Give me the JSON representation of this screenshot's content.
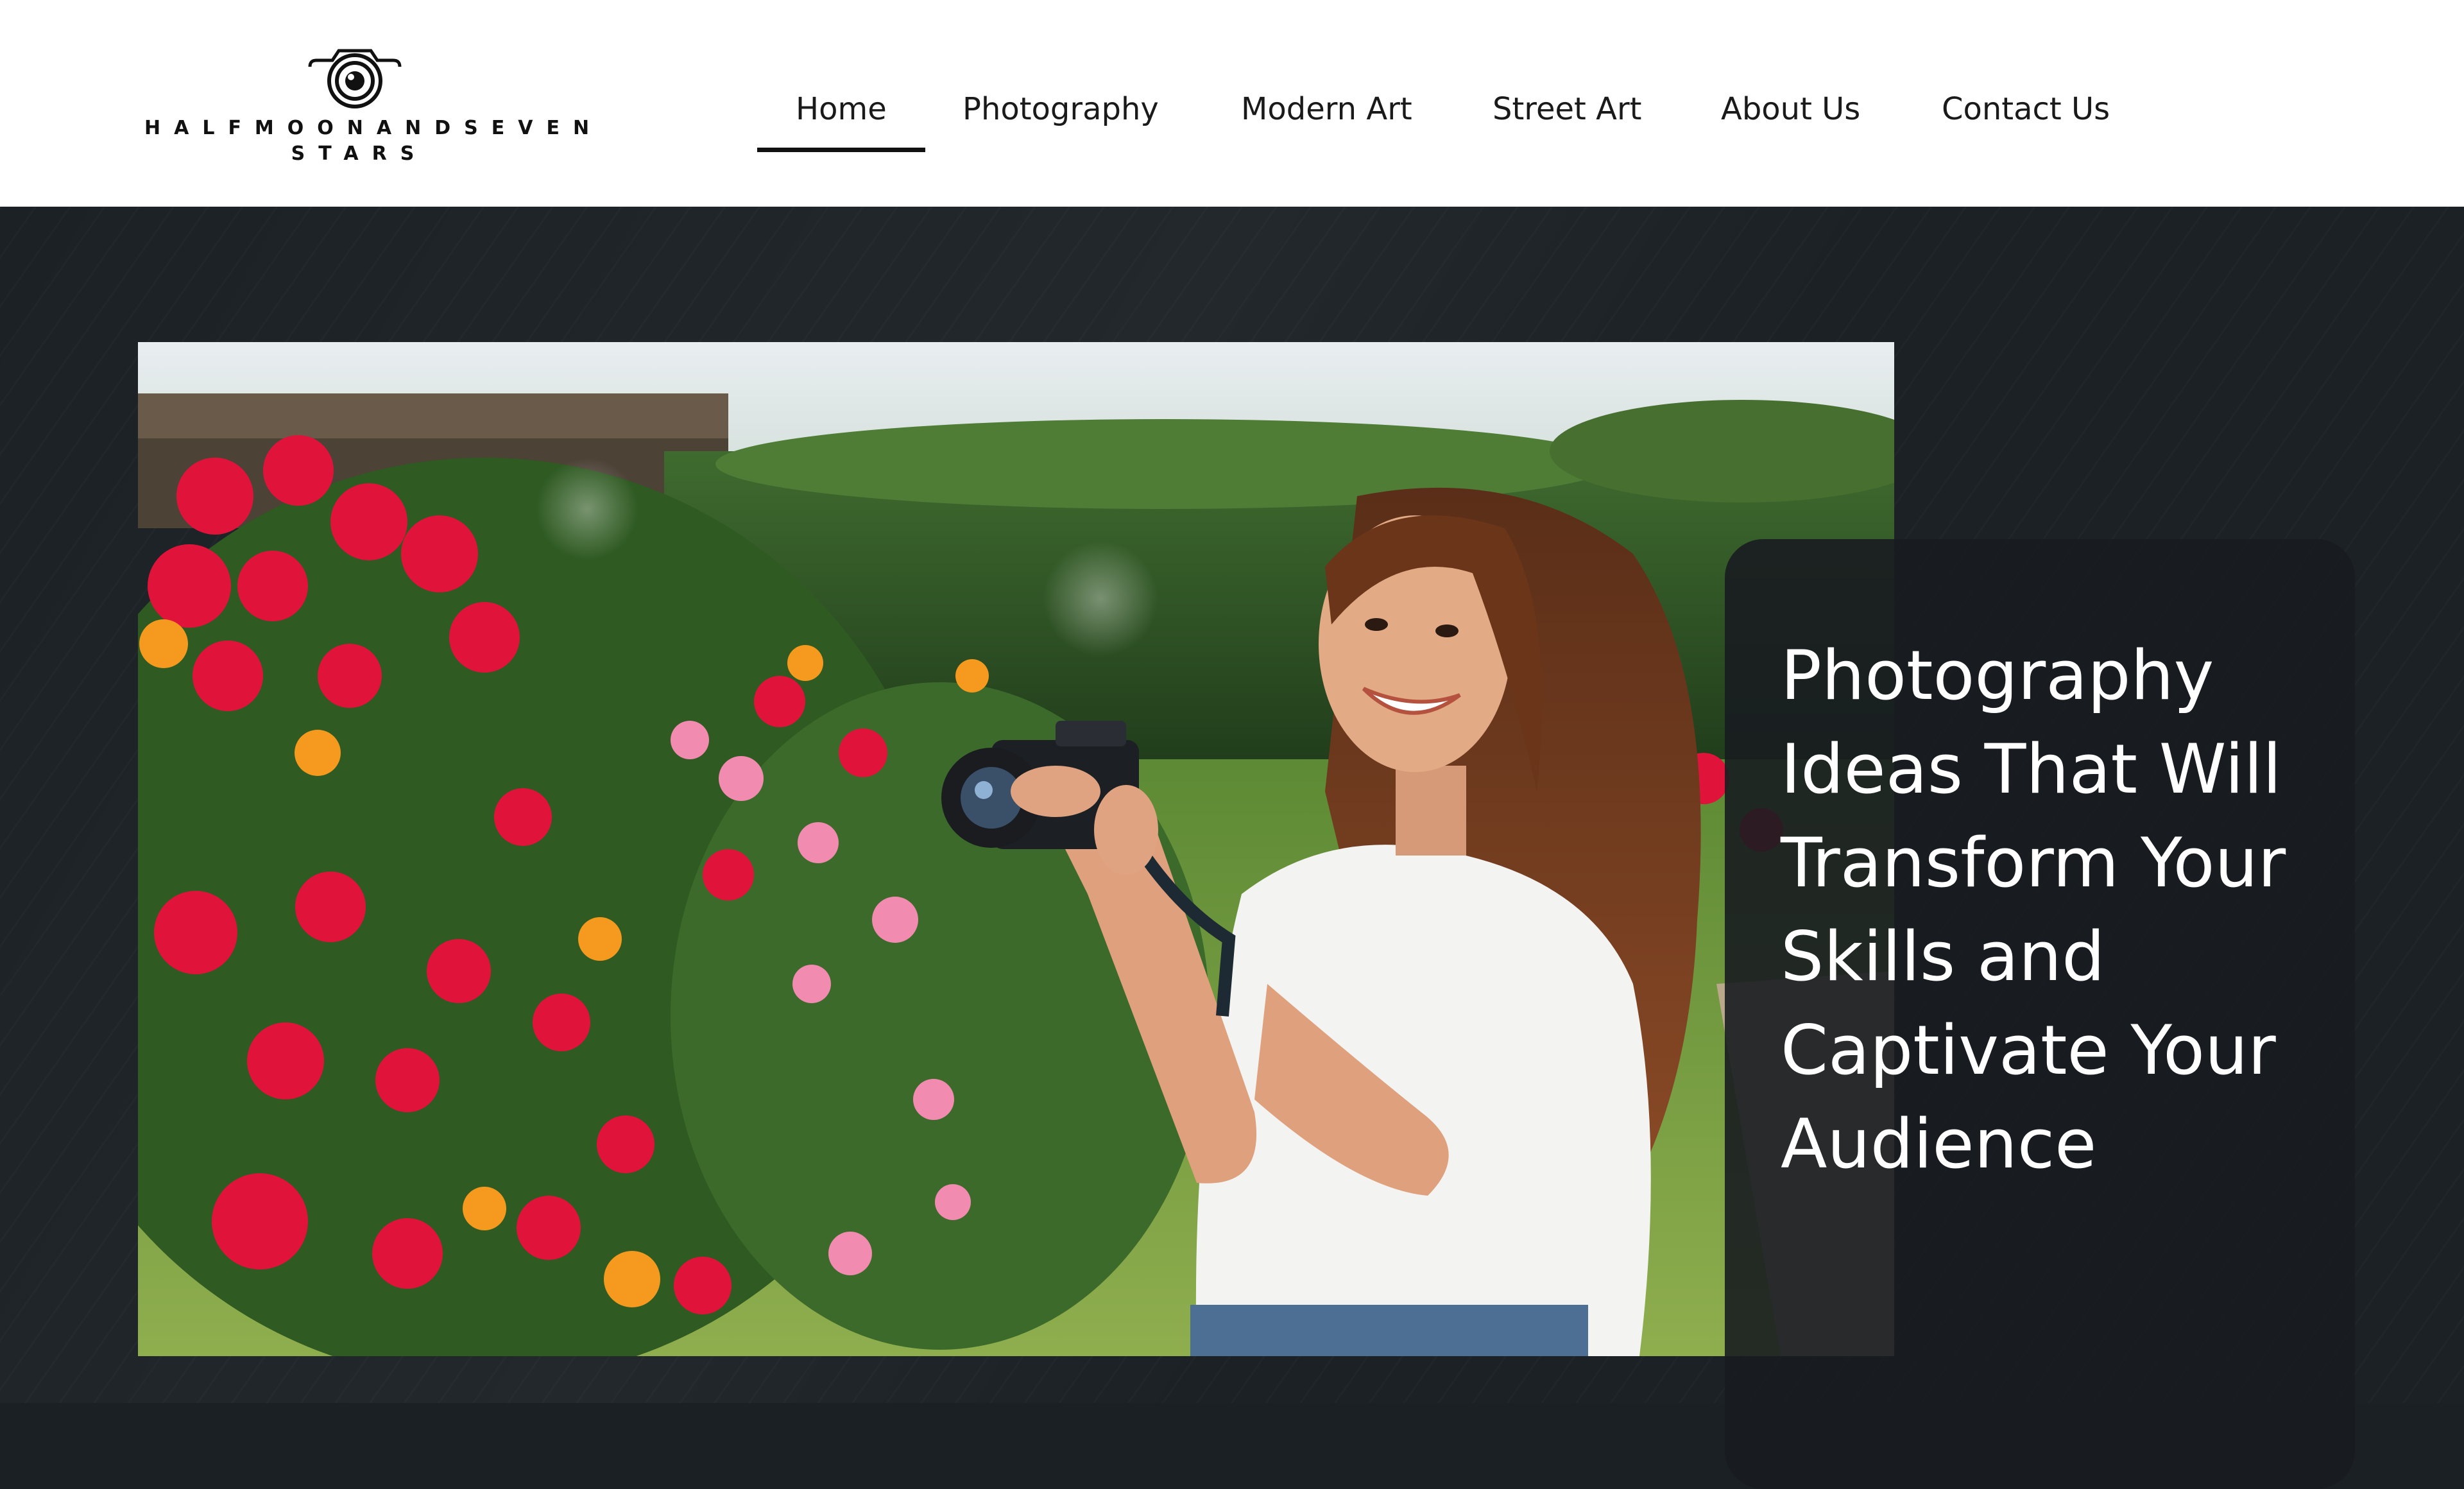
{
  "brand": {
    "name_line1": "HALFMOONANDSEVEN",
    "name_line2": "STARS",
    "logo_icon": "camera-icon"
  },
  "nav": {
    "items": [
      {
        "label": "Home",
        "active": true
      },
      {
        "label": "Photography",
        "active": false
      },
      {
        "label": "Modern Art",
        "active": false
      },
      {
        "label": "Street Art",
        "active": false
      },
      {
        "label": "About Us",
        "active": false
      },
      {
        "label": "Contact Us",
        "active": false
      }
    ]
  },
  "hero": {
    "title": "Photography Ideas That Will Transform Your Skills and Captivate Your Audience",
    "image_subject": "hero-photo"
  },
  "colors": {
    "header_bg": "#ffffff",
    "hero_bg": "#1b2125",
    "card_bg": "#181c20",
    "text_light": "#ffffff",
    "text_dark": "#1a1a1a"
  }
}
